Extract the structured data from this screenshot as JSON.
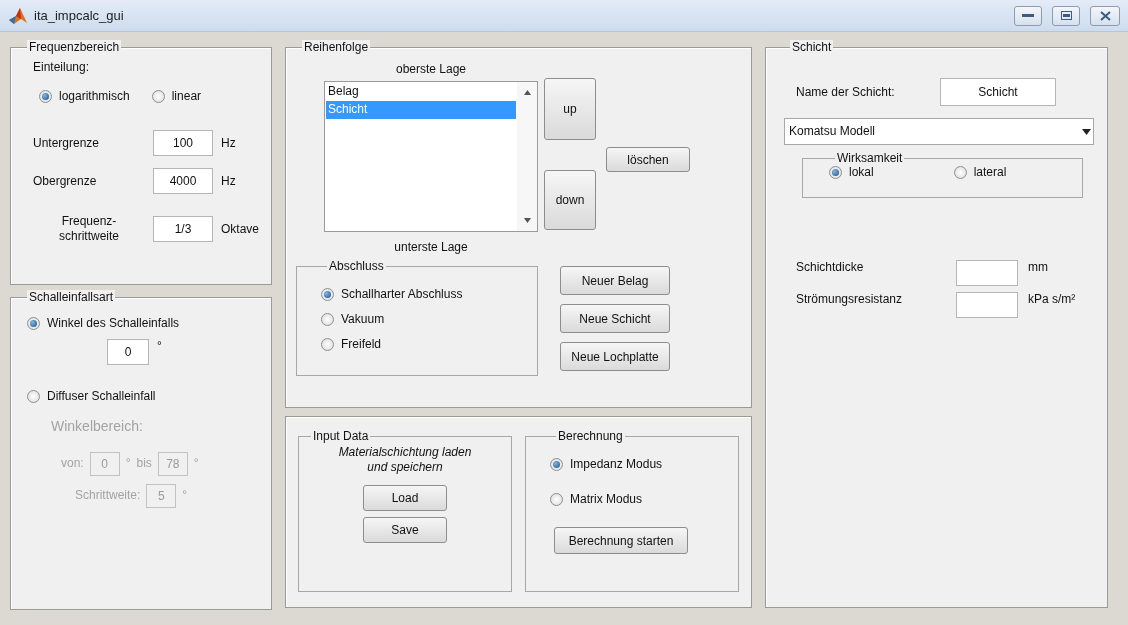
{
  "window": {
    "title": "ita_impcalc_gui"
  },
  "frequenzbereich": {
    "title": "Frequenzbereich",
    "einteilung_label": "Einteilung:",
    "options": [
      {
        "label": "logarithmisch",
        "selected": true
      },
      {
        "label": "linear",
        "selected": false
      }
    ],
    "fields": [
      {
        "label": "Untergrenze",
        "value": "100",
        "unit": "Hz"
      },
      {
        "label": "Obergrenze",
        "value": "4000",
        "unit": "Hz"
      },
      {
        "label": "Frequenz-\nschrittweite",
        "value": "1/3",
        "unit": "Oktave"
      }
    ]
  },
  "schalleinfallsart": {
    "title": "Schalleinfallsart",
    "winkel": {
      "label": "Winkel des Schalleinfalls",
      "selected": true,
      "value": "0",
      "unit": "°"
    },
    "diffus": {
      "label": "Diffuser Schalleinfall",
      "selected": false,
      "disabled": true,
      "range_label": "Winkelbereich:",
      "von_label": "von:",
      "von": "0",
      "von_unit": "°",
      "bis_label": "bis",
      "bis": "78",
      "bis_unit": "°",
      "schritt_label": "Schrittweite:",
      "schritt": "5",
      "schritt_unit": "°"
    }
  },
  "reihenfolge": {
    "title": "Reihenfolge",
    "top_label": "oberste Lage",
    "bottom_label": "unterste Lage",
    "layers": [
      {
        "label": "Belag",
        "selected": false
      },
      {
        "label": "Schicht",
        "selected": true
      }
    ],
    "up_button": "up",
    "down_button": "down",
    "delete_button": "löschen",
    "abschluss": {
      "title": "Abschluss",
      "options": [
        {
          "label": "Schallharter Abschluss",
          "selected": true
        },
        {
          "label": "Vakuum",
          "selected": false
        },
        {
          "label": "Freifeld",
          "selected": false
        }
      ]
    },
    "new_buttons": [
      "Neuer Belag",
      "Neue Schicht",
      "Neue Lochplatte"
    ]
  },
  "input_data": {
    "title": "Input Data",
    "hint": "Materialschichtung laden und speichern",
    "buttons": [
      "Load",
      "Save"
    ]
  },
  "berechnung": {
    "title": "Berechnung",
    "options": [
      {
        "label": "Impedanz Modus",
        "selected": true
      },
      {
        "label": "Matrix Modus",
        "selected": false
      }
    ],
    "button": "Berechnung starten"
  },
  "schicht": {
    "title": "Schicht",
    "name_label": "Name der Schicht:",
    "name_value": "Schicht",
    "model": "Komatsu Modell",
    "wirksamkeit": {
      "title": "Wirksamkeit",
      "options": [
        {
          "label": "lokal",
          "selected": true
        },
        {
          "label": "lateral",
          "selected": false
        }
      ]
    },
    "fields": [
      {
        "label": "Schichtdicke",
        "unit": "mm"
      },
      {
        "label": "Strömungsresistanz",
        "unit": "kPa s/m²"
      }
    ]
  }
}
